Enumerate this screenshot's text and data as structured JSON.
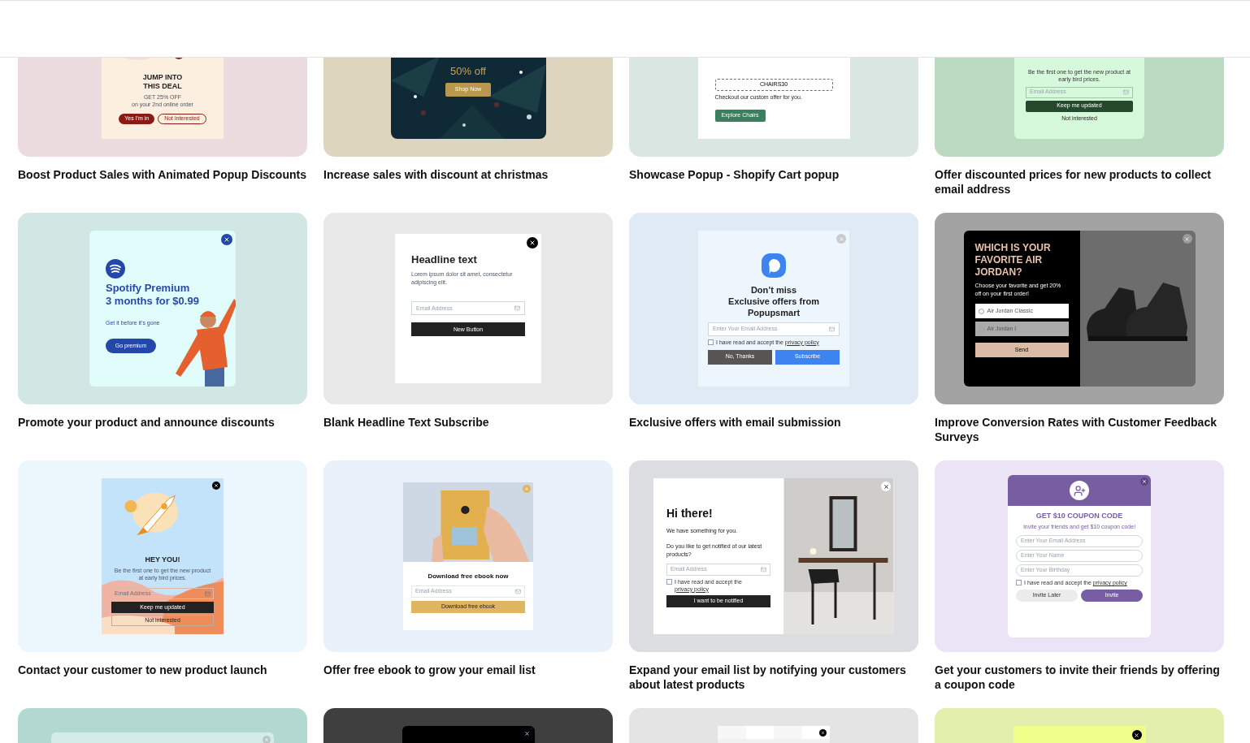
{
  "cards": [
    {
      "title": "Boost Product Sales with Animated Popup Discounts",
      "preview": {
        "kind": "deal",
        "heading_lines": [
          "JUMP INTO",
          "THIS DEAL"
        ],
        "offer": "GET 25% OFF",
        "note": "on your 2nd online order",
        "buttons": [
          "Yes I'm in",
          "Not interested"
        ]
      }
    },
    {
      "title": "Increase sales with discount at christmas",
      "preview": {
        "kind": "christmas",
        "headline": "50% off",
        "button": "Shop Now"
      }
    },
    {
      "title": "Showcase Popup - Shopify Cart popup",
      "preview": {
        "kind": "chairs",
        "code": "CHAIRS30",
        "text": "Checkout our custom offer for you.",
        "button": "Explore Chairs"
      }
    },
    {
      "title": "Offer discounted prices for new products to collect email address",
      "preview": {
        "kind": "early-bird",
        "text": "Be the first one to get the new product at early bird prices.",
        "email_placeholder": "Email Address",
        "button": "Keep me updated",
        "link": "Not interested"
      }
    },
    {
      "title": "Promote your product and announce discounts",
      "preview": {
        "kind": "spotify",
        "heading_lines": [
          "Spotify Premium",
          "3 months for $0.99"
        ],
        "text": "Get it before it’s gone",
        "button": "Go premium"
      }
    },
    {
      "title": "Blank Headline Text Subscribe",
      "preview": {
        "kind": "headline",
        "heading": "Headline text",
        "text": "Lorem ipsum dolor sit amet, consectetur adipiscing elit.",
        "email_placeholder": "Email Address",
        "button": "New Button"
      }
    },
    {
      "title": "Exclusive offers with email submission",
      "preview": {
        "kind": "exclusive",
        "heading_lines": [
          "Don’t miss",
          "Exclusive offers from",
          "Popupsmart"
        ],
        "email_placeholder": "Enter Your Email Address",
        "consent": "I have read and accept the",
        "consent_link": "privacy policy",
        "consent_checked": false,
        "buttons": [
          "No, Thanks",
          "Subscribe"
        ]
      }
    },
    {
      "title": "Improve Conversion Rates with Customer Feedback Surveys",
      "preview": {
        "kind": "survey",
        "heading": "WHICH IS YOUR FAVORITE AIR JORDAN?",
        "text": "Choose your favorite and get 20% off on your first order!",
        "options": [
          {
            "label": "Air Jordan Classic",
            "selected": false,
            "highlighted": false
          },
          {
            "label": "Air Jordan I",
            "selected": false,
            "highlighted": true
          }
        ],
        "button": "Send"
      }
    },
    {
      "title": "Contact your customer to new product launch",
      "preview": {
        "kind": "rocket",
        "heading": "HEY YOU!",
        "text": "Be the first one to get the new product at early bird prices.",
        "email_placeholder": "Email Address",
        "button": "Keep me updated",
        "secondary_button": "Not interested"
      }
    },
    {
      "title": "Offer free ebook to grow your email list",
      "preview": {
        "kind": "ebook",
        "heading": "Download free ebook now",
        "email_placeholder": "Email Address",
        "button": "Download free ebook"
      }
    },
    {
      "title": "Expand your email list by notifying your customers about latest products",
      "preview": {
        "kind": "notify",
        "heading": "Hi there!",
        "text": "We have something for you.",
        "question": "Do you like to get notified of our latest products?",
        "email_placeholder": "Email Address",
        "consent": "I have read and accept the",
        "consent_link": "privacy policy",
        "consent_checked": false,
        "button": "I want to be notified"
      }
    },
    {
      "title": "Get your customers to invite their friends by offering a coupon code",
      "preview": {
        "kind": "invite",
        "heading": "GET $10 COUPON CODE",
        "text": "Invite your friends and get $10 coupon code!",
        "fields": [
          "Enter Your Email Address",
          "Enter Your Name",
          "Enter Your Birthday"
        ],
        "consent": "I have read and accept the",
        "consent_link": "privacy policy",
        "consent_checked": false,
        "buttons": [
          "Invite Later",
          "Invite"
        ]
      }
    },
    {
      "preview": {
        "kind": "teal"
      }
    },
    {
      "preview": {
        "kind": "dark"
      }
    },
    {
      "preview": {
        "kind": "light"
      }
    },
    {
      "preview": {
        "kind": "lime"
      }
    }
  ]
}
